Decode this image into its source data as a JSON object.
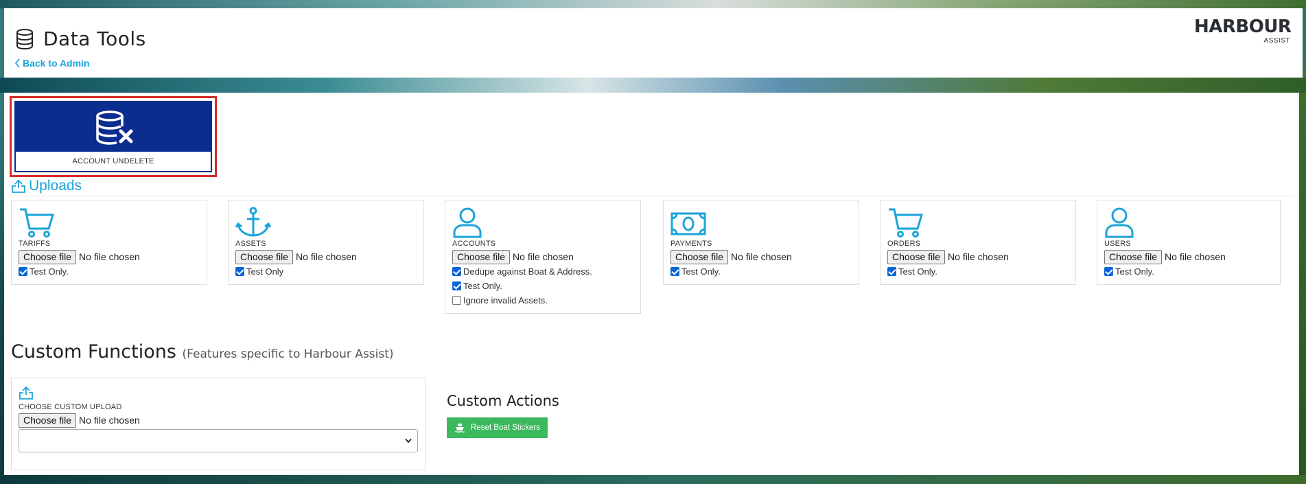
{
  "header": {
    "title": "Data Tools",
    "back_link": "Back to Admin",
    "logo_main": "HARBOUR",
    "logo_sub": "ASSIST"
  },
  "undelete": {
    "label": "ACCOUNT UNDELETE"
  },
  "uploads": {
    "heading": "Uploads",
    "choose_file_label": "Choose file",
    "no_file_label": "No file chosen",
    "cards": [
      {
        "label": "TARIFFS",
        "icon": "cart-icon",
        "checks": [
          {
            "label": "Test Only.",
            "checked": true
          }
        ]
      },
      {
        "label": "ASSETS",
        "icon": "anchor-icon",
        "checks": [
          {
            "label": "Test Only",
            "checked": true
          }
        ]
      },
      {
        "label": "ACCOUNTS",
        "icon": "user-icon",
        "checks": [
          {
            "label": "Dedupe against Boat & Address.",
            "checked": true
          },
          {
            "label": "Test Only.",
            "checked": true
          },
          {
            "label": "Ignore invalid Assets.",
            "checked": false
          }
        ]
      },
      {
        "label": "PAYMENTS",
        "icon": "money-icon",
        "checks": [
          {
            "label": "Test Only.",
            "checked": true
          }
        ]
      },
      {
        "label": "ORDERS",
        "icon": "cart-icon",
        "checks": [
          {
            "label": "Test Only.",
            "checked": true
          }
        ]
      },
      {
        "label": "USERS",
        "icon": "user-icon",
        "checks": [
          {
            "label": "Test Only.",
            "checked": true
          }
        ]
      }
    ]
  },
  "custom": {
    "heading": "Custom Functions",
    "subheading": "(Features specific to Harbour Assist)",
    "upload_label": "CHOOSE CUSTOM UPLOAD",
    "choose_file_label": "Choose file",
    "no_file_label": "No file chosen",
    "select_value": ""
  },
  "actions": {
    "heading": "Custom Actions",
    "reset_button": "Reset Boat Stickers"
  },
  "colors": {
    "accent": "#1aa3d9",
    "tile_blue": "#0b2d8f",
    "highlight_red": "#d52b2b",
    "button_green": "#3cb95c"
  }
}
